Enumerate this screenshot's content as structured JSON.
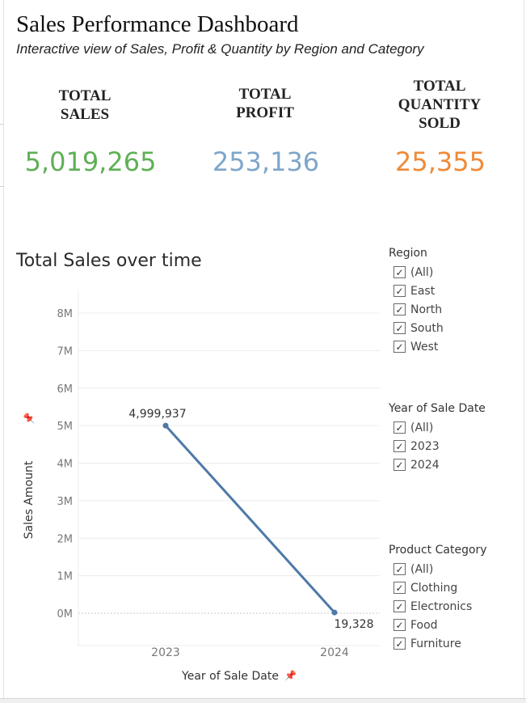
{
  "header": {
    "title": "Sales Performance Dashboard",
    "subtitle": "Interactive view of Sales, Profit & Quantity by Region and Category"
  },
  "kpis": [
    {
      "label_lines": [
        "TOTAL",
        "SALES"
      ],
      "value": "5,019,265",
      "color": "#5fb055"
    },
    {
      "label_lines": [
        "TOTAL",
        "PROFIT"
      ],
      "value": "253,136",
      "color": "#7ea6c9"
    },
    {
      "label_lines": [
        "TOTAL",
        "QUANTITY",
        "SOLD"
      ],
      "value": "25,355",
      "color": "#ef8a37"
    }
  ],
  "chart_title": "Total Sales over time",
  "chart_data": {
    "type": "line",
    "x": [
      "2023",
      "2024"
    ],
    "series": [
      {
        "values": [
          4999937,
          19328
        ]
      }
    ],
    "data_labels": [
      "4,999,937",
      "19,328"
    ],
    "y_ticks": [
      "0M",
      "1M",
      "2M",
      "3M",
      "4M",
      "5M",
      "6M",
      "7M",
      "8M"
    ],
    "ylim": [
      0,
      8000000
    ],
    "xlabel": "Year of Sale Date",
    "ylabel": "Sales Amount",
    "grid": true,
    "line_color": "#4e79a7"
  },
  "filters": [
    {
      "title": "Region",
      "items": [
        "(All)",
        "East",
        "North",
        "South",
        "West"
      ]
    },
    {
      "title": "Year of Sale Date",
      "items": [
        "(All)",
        "2023",
        "2024"
      ]
    },
    {
      "title": "Product Category",
      "items": [
        "(All)",
        "Clothing",
        "Electronics",
        "Food",
        "Furniture"
      ]
    }
  ],
  "checkbox_glyph": "✓",
  "pin_icon": "pin-icon"
}
